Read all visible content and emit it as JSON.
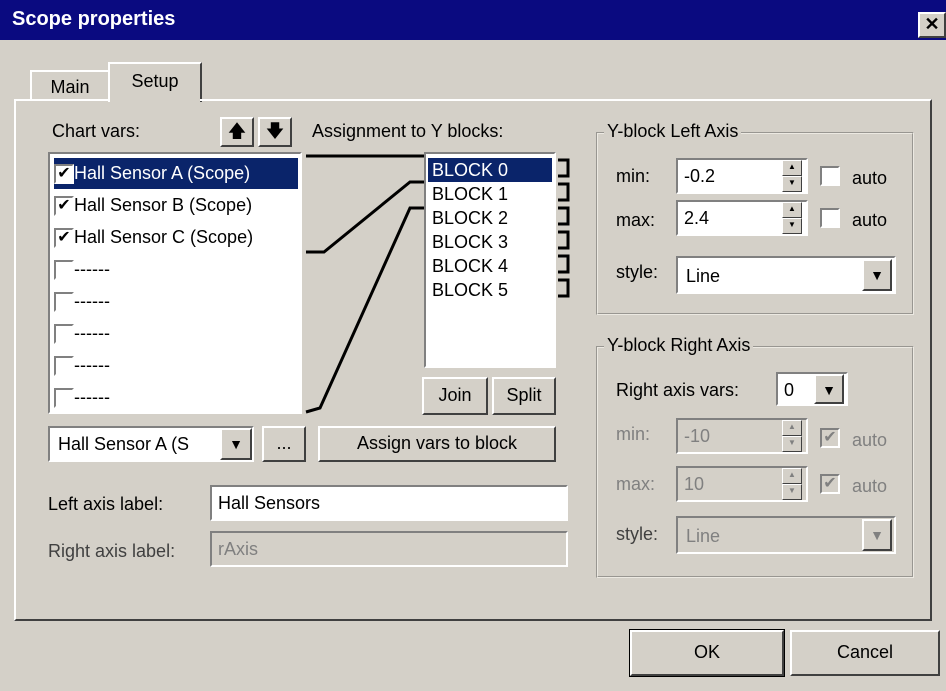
{
  "window": {
    "title": "Scope properties",
    "close": "✕"
  },
  "tabs": [
    {
      "label": "Main"
    },
    {
      "label": "Setup"
    }
  ],
  "chart_vars": {
    "label": "Chart vars:",
    "up": "🡅",
    "down": "🡇",
    "items": [
      {
        "label": "Hall Sensor A (Scope)",
        "checked": "✔"
      },
      {
        "label": "Hall Sensor B (Scope)",
        "checked": "✔"
      },
      {
        "label": "Hall Sensor C (Scope)",
        "checked": "✔"
      },
      {
        "label": "------",
        "checked": ""
      },
      {
        "label": "------",
        "checked": ""
      },
      {
        "label": "------",
        "checked": ""
      },
      {
        "label": "------",
        "checked": ""
      },
      {
        "label": "------",
        "checked": ""
      }
    ]
  },
  "assignment": {
    "label": "Assignment to Y blocks:",
    "blocks": [
      "BLOCK 0",
      "BLOCK 1",
      "BLOCK 2",
      "BLOCK 3",
      "BLOCK 4",
      "BLOCK 5"
    ],
    "join": "Join",
    "split": "Split"
  },
  "var_select": {
    "value": "Hall Sensor A (S"
  },
  "ellipsis": "...",
  "assign_button": "Assign vars to block",
  "left_axis_label": {
    "label": "Left axis label:",
    "value": "Hall Sensors"
  },
  "right_axis_label": {
    "label": "Right axis label:",
    "value": "rAxis"
  },
  "left_axis": {
    "legend": "Y-block Left Axis",
    "min_label": "min:",
    "min_value": "-0.2",
    "max_label": "max:",
    "max_value": "2.4",
    "auto": "auto",
    "style_label": "style:",
    "style_value": "Line"
  },
  "right_axis": {
    "legend": "Y-block Right Axis",
    "vars_label": "Right axis vars:",
    "vars_value": "0",
    "min_label": "min:",
    "min_value": "-10",
    "max_label": "max:",
    "max_value": "10",
    "auto": "auto",
    "style_label": "style:",
    "style_value": "Line"
  },
  "footer": {
    "ok": "OK",
    "cancel": "Cancel"
  }
}
